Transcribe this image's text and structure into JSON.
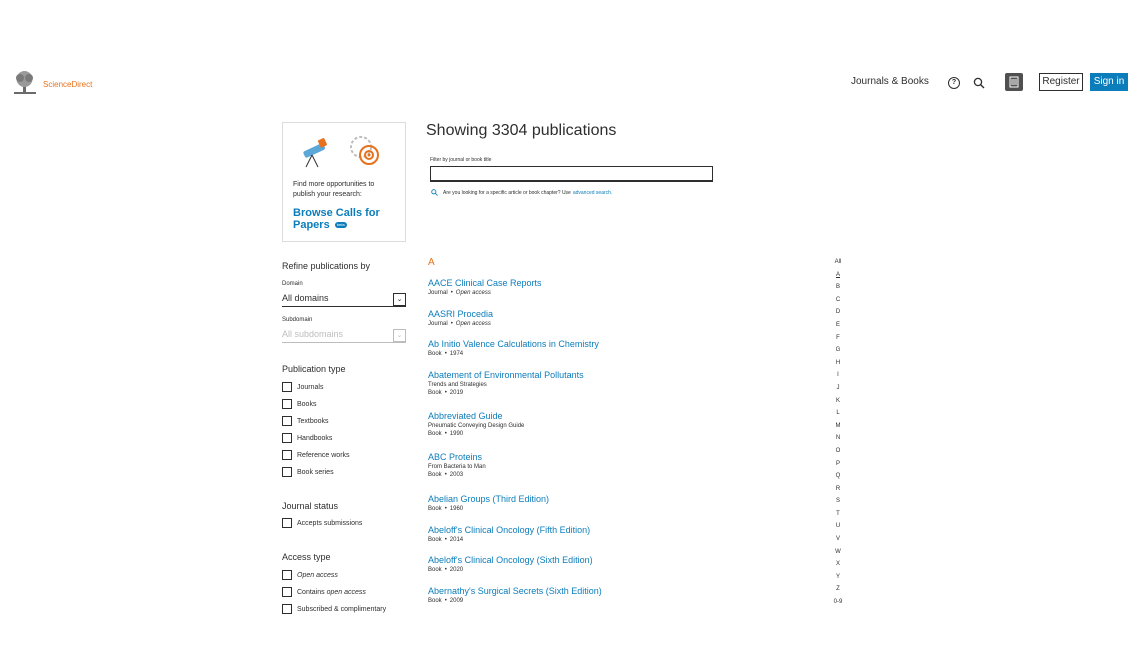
{
  "header": {
    "brand": "ScienceDirect",
    "nav_journals": "Journals & Books",
    "help_icon": "question-circle",
    "search_icon": "magnifier",
    "institution_icon": "building",
    "register_label": "Register",
    "signin_label": "Sign in",
    "colors": {
      "brand_orange": "#e9711c",
      "link_blue": "#0c7dbb"
    }
  },
  "promo": {
    "text": "Find more opportunities to publish your research:",
    "link": "Browse Calls for Papers",
    "badge": "beta"
  },
  "refine": {
    "heading": "Refine publications by",
    "domain_label": "Domain",
    "domain_value": "All domains",
    "subdomain_label": "Subdomain",
    "subdomain_value": "All subdomains",
    "pub_type_heading": "Publication type",
    "pub_types": [
      "Journals",
      "Books",
      "Textbooks",
      "Handbooks",
      "Reference works",
      "Book series"
    ],
    "journal_status_heading": "Journal status",
    "journal_status": [
      "Accepts submissions"
    ],
    "access_heading": "Access type",
    "access_open": "Open access",
    "access_contains_prefix": "Contains ",
    "access_contains_italic": "open access",
    "access_subscribed": "Subscribed & complimentary"
  },
  "main": {
    "showing": "Showing 3304 publications",
    "filter_label": "Filter by journal or book title",
    "filter_value": "",
    "hint_prefix": "Are you looking for a specific article or book chapter? Use",
    "hint_link": "advanced search.",
    "letter": "A",
    "publications": [
      {
        "title": "AACE Clinical Case Reports",
        "sub": "",
        "type": "Journal",
        "detail": "Open access"
      },
      {
        "title": "AASRI Procedia",
        "sub": "",
        "type": "Journal",
        "detail": "Open access"
      },
      {
        "title": "Ab Initio Valence Calculations in Chemistry",
        "sub": "",
        "type": "Book",
        "detail": "1974"
      },
      {
        "title": "Abatement of Environmental Pollutants",
        "sub": "Trends and Strategies",
        "type": "Book",
        "detail": "2019"
      },
      {
        "title": "Abbreviated Guide",
        "sub": "Pneumatic Conveying Design Guide",
        "type": "Book",
        "detail": "1990"
      },
      {
        "title": "ABC Proteins",
        "sub": "From Bacteria to Man",
        "type": "Book",
        "detail": "2003"
      },
      {
        "title": "Abelian Groups (Third Edition)",
        "sub": "",
        "type": "Book",
        "detail": "1960"
      },
      {
        "title": "Abeloff's Clinical Oncology (Fifth Edition)",
        "sub": "",
        "type": "Book",
        "detail": "2014"
      },
      {
        "title": "Abeloff's Clinical Oncology (Sixth Edition)",
        "sub": "",
        "type": "Book",
        "detail": "2020"
      },
      {
        "title": "Abernathy's Surgical Secrets (Sixth Edition)",
        "sub": "",
        "type": "Book",
        "detail": "2009"
      }
    ]
  },
  "alphabet": [
    "All",
    "A",
    "B",
    "C",
    "D",
    "E",
    "F",
    "G",
    "H",
    "I",
    "J",
    "K",
    "L",
    "M",
    "N",
    "O",
    "P",
    "Q",
    "R",
    "S",
    "T",
    "U",
    "V",
    "W",
    "X",
    "Y",
    "Z",
    "0-9"
  ],
  "alphabet_active": "A"
}
